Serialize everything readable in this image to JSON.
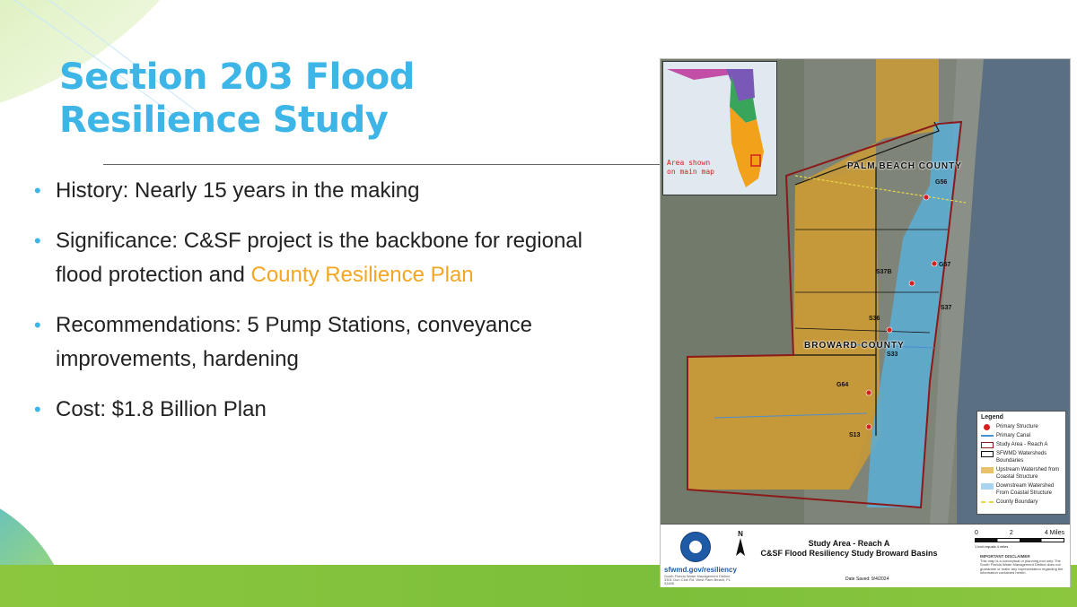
{
  "slide": {
    "title_line1": "Section 203 Flood",
    "title_line2": "Resilience Study",
    "bullets": [
      {
        "text": "History: Nearly 15 years in the making"
      },
      {
        "text": "Significance: C&SF project is the backbone for regional flood protection and ",
        "accent": "County Resilience Plan"
      },
      {
        "text": "Recommendations: 5 Pump Stations, conveyance improvements, hardening"
      },
      {
        "text": "Cost: $1.8 Billion Plan"
      }
    ],
    "colors": {
      "title": "#3db5e6",
      "accent": "#f5a623",
      "band": "#8cc63f"
    }
  },
  "map": {
    "inset_label": "Area shown\non main map",
    "county_labels": {
      "palm_beach": "PALM BEACH COUNTY",
      "broward": "BROWARD COUNTY"
    },
    "structures": {
      "g56": "G56",
      "g57": "G57",
      "s37b": "S37B",
      "s37": "S37",
      "s36": "S36",
      "s33": "S33",
      "g64": "G64",
      "s13": "S13"
    },
    "legend": {
      "title": "Legend",
      "items": [
        {
          "label": "Primary Structure"
        },
        {
          "label": "Primary Canal"
        },
        {
          "label": "Study Area - Reach A"
        },
        {
          "label": "SFWMD Watersheds Boundaries"
        },
        {
          "label": "Upstream Watershed from Coastal Structure"
        },
        {
          "label": "Downstream Watershed From Coastal Structure"
        },
        {
          "label": "County Boundary"
        }
      ]
    },
    "title_block": {
      "north": "N",
      "title_line1": "Study Area - Reach A",
      "title_line2": "C&SF Flood Resiliency Study Broward Basins",
      "logo_text": "sfwmd.gov/resiliency",
      "logo_small": "South Florida Water Management District 3301 Gun Club Rd, West Palm Beach, FL 33406",
      "scale_labels": [
        "0",
        "2",
        "4 Miles"
      ],
      "scale_note": "1 inch equals 4 miles",
      "disclaimer_title": "IMPORTANT DISCLAIMER",
      "disclaimer_text": "This map is a conceptual or planning tool only. The South Florida Water Management District does not guarantee or make any representation regarding the information contained herein.",
      "date_saved": "Date Saved: 9/4/2024"
    }
  }
}
